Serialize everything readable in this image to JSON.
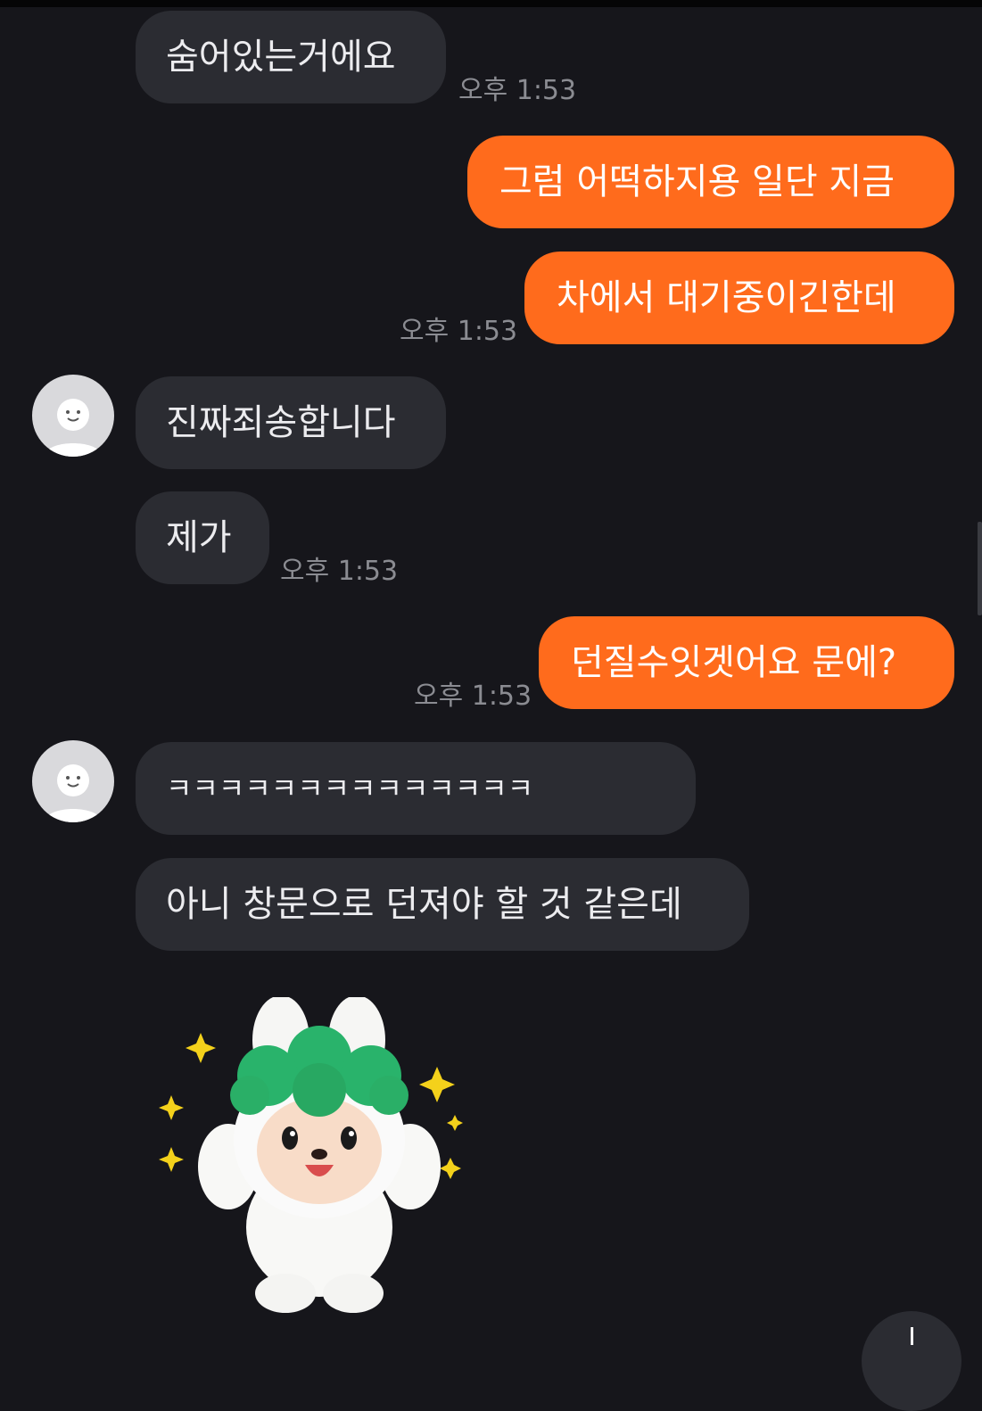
{
  "messages": [
    {
      "side": "in",
      "text": "숨어있는거에요",
      "time": "오후 1:53"
    },
    {
      "side": "out",
      "text": "그럼 어떡하지용 일단 지금"
    },
    {
      "side": "out",
      "text": "차에서 대기중이긴한데",
      "time": "오후 1:53"
    },
    {
      "side": "in",
      "text": "진짜죄송합니다"
    },
    {
      "side": "in",
      "text": "제가",
      "time": "오후 1:53"
    },
    {
      "side": "out",
      "text": "던질수잇겟어요 문에?",
      "time": "오후 1:53"
    },
    {
      "side": "in",
      "text": "ㅋㅋㅋㅋㅋㅋㅋㅋㅋㅋㅋㅋㅋㅋ"
    },
    {
      "side": "in",
      "text": "아니 창문으로 던져야 할 것 같은데"
    }
  ],
  "icons": {
    "avatar": "default-profile-icon",
    "sticker": "white-bunny-green-hat-sticker",
    "scroll": "scroll-down-icon"
  },
  "colors": {
    "background": "#16161b",
    "incoming_bubble": "#2b2c32",
    "outgoing_bubble": "#ff6b1c",
    "timestamp": "#8b8c92"
  }
}
